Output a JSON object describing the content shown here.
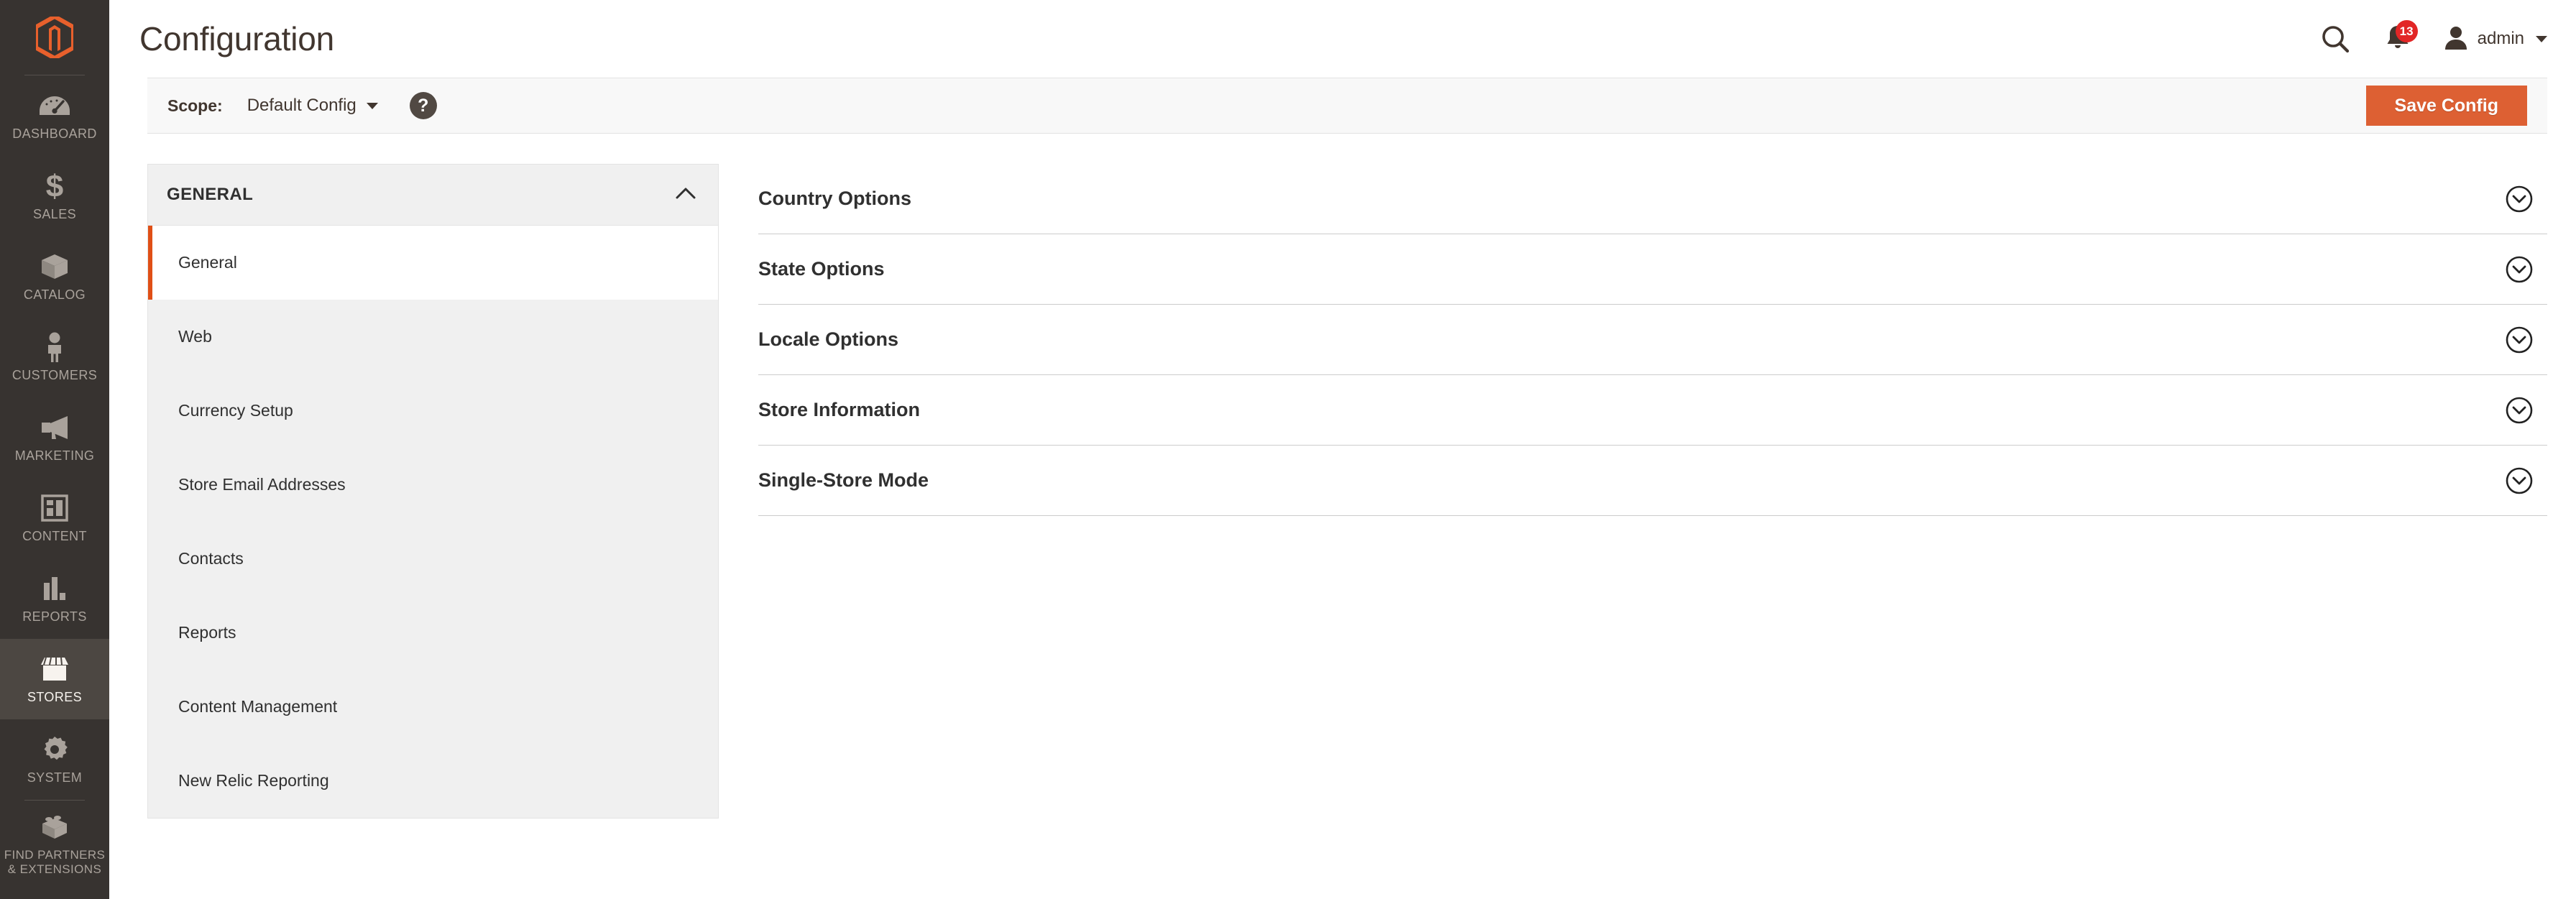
{
  "app": {
    "brand_color": "#e8602c",
    "sidebar_bg": "#373330",
    "accent_orange": "#dd6033",
    "badge_color": "#e22626"
  },
  "sidebar": {
    "logo_name": "magento-logo",
    "items": [
      {
        "label": "DASHBOARD",
        "icon": "dashboard-gauge-icon",
        "active": false
      },
      {
        "label": "SALES",
        "icon": "dollar-sign-icon",
        "active": false
      },
      {
        "label": "CATALOG",
        "icon": "box-icon",
        "active": false
      },
      {
        "label": "CUSTOMERS",
        "icon": "person-icon",
        "active": false
      },
      {
        "label": "MARKETING",
        "icon": "megaphone-icon",
        "active": false
      },
      {
        "label": "CONTENT",
        "icon": "layout-window-icon",
        "active": false
      },
      {
        "label": "REPORTS",
        "icon": "bar-chart-icon",
        "active": false
      },
      {
        "label": "STORES",
        "icon": "storefront-icon",
        "active": true
      },
      {
        "label": "SYSTEM",
        "icon": "gear-icon",
        "active": false
      },
      {
        "label": "FIND PARTNERS\n& EXTENSIONS",
        "icon": "lego-brick-icon",
        "active": false
      }
    ]
  },
  "header": {
    "title": "Configuration",
    "search_icon": "search-icon",
    "notifications": {
      "icon": "bell-icon",
      "count": "13"
    },
    "user": {
      "avatar_icon": "user-avatar-icon",
      "name": "admin",
      "caret_icon": "chevron-down-icon"
    }
  },
  "scope_bar": {
    "label": "Scope:",
    "selected": "Default Config",
    "caret_icon": "chevron-down-icon",
    "help_icon": "question-mark-icon",
    "help_glyph": "?",
    "save_label": "Save Config"
  },
  "config_nav": {
    "section_label": "GENERAL",
    "collapse_icon": "chevron-up-icon",
    "items": [
      {
        "label": "General",
        "active": true
      },
      {
        "label": "Web",
        "active": false
      },
      {
        "label": "Currency Setup",
        "active": false
      },
      {
        "label": "Store Email Addresses",
        "active": false
      },
      {
        "label": "Contacts",
        "active": false
      },
      {
        "label": "Reports",
        "active": false
      },
      {
        "label": "Content Management",
        "active": false
      },
      {
        "label": "New Relic Reporting",
        "active": false
      }
    ]
  },
  "config_main": {
    "expand_icon": "chevron-down-circle-icon",
    "sections": [
      {
        "title": "Country Options"
      },
      {
        "title": "State Options"
      },
      {
        "title": "Locale Options"
      },
      {
        "title": "Store Information"
      },
      {
        "title": "Single-Store Mode"
      }
    ]
  }
}
